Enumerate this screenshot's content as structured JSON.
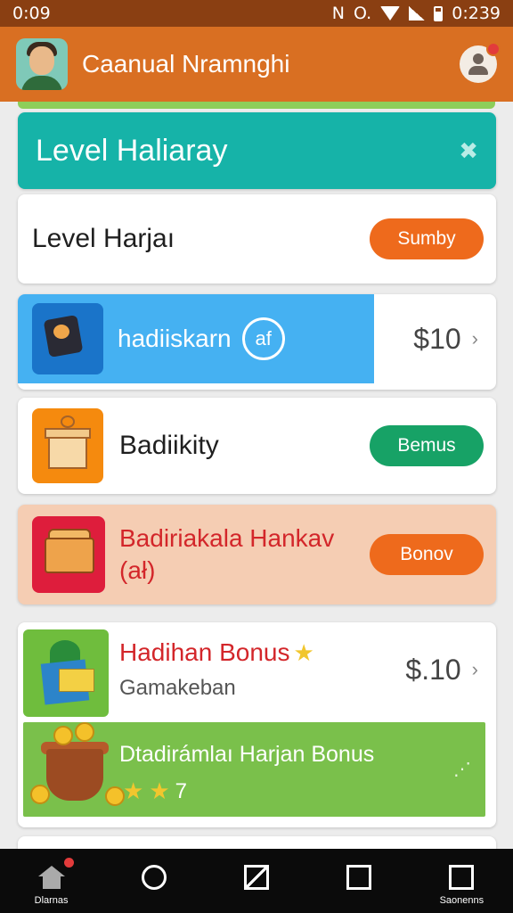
{
  "status_bar": {
    "time_left": "0:09",
    "time_right": "0:239",
    "left_glyph": "N",
    "center_glyph": "O."
  },
  "app_bar": {
    "title": "Caanual Nramnghi",
    "notification": true
  },
  "header_card": {
    "title": "Level Haliaray",
    "icon": "✖"
  },
  "level_row": {
    "title": "Level Harjaı",
    "button": "Sumby"
  },
  "promo_row": {
    "label": "hadiiskarn",
    "badge": "af",
    "price": "$10",
    "chevron": "›"
  },
  "bonus_row": {
    "title": "Badiikity",
    "button": "Bemus"
  },
  "hankav_row": {
    "title": "Badiriakala Hankav",
    "subtitle": "(ał)",
    "button": "Bonov"
  },
  "bonus_card": {
    "title": "Hadihan Bonus",
    "subtitle": "Gamakeban",
    "price": "$.10",
    "chevron": "›",
    "panel": {
      "label": "Dtadirámlaı Harjan Bonus",
      "stars_value": "7",
      "more": "⋰"
    }
  },
  "bottom_nav": [
    {
      "label": "Dlarnas"
    },
    {
      "label": ""
    },
    {
      "label": ""
    },
    {
      "label": ""
    },
    {
      "label": "Saonenns"
    }
  ],
  "colors": {
    "app_bar": "#d96f22",
    "teal": "#16b3a8",
    "orange_button": "#ee6a1c",
    "green_button": "#17a266",
    "promo_blue": "#45b1f2",
    "bonus_green": "#7ac04b",
    "title_red": "#d3262a"
  },
  "icons": [
    "avatar",
    "profile-icon",
    "collapse-icon",
    "tablet-icon",
    "gift-icon",
    "chest-icon",
    "money-plant-icon",
    "coin-pot-icon",
    "home-icon",
    "info-icon",
    "edit-icon",
    "inbox-icon",
    "menu-icon"
  ]
}
